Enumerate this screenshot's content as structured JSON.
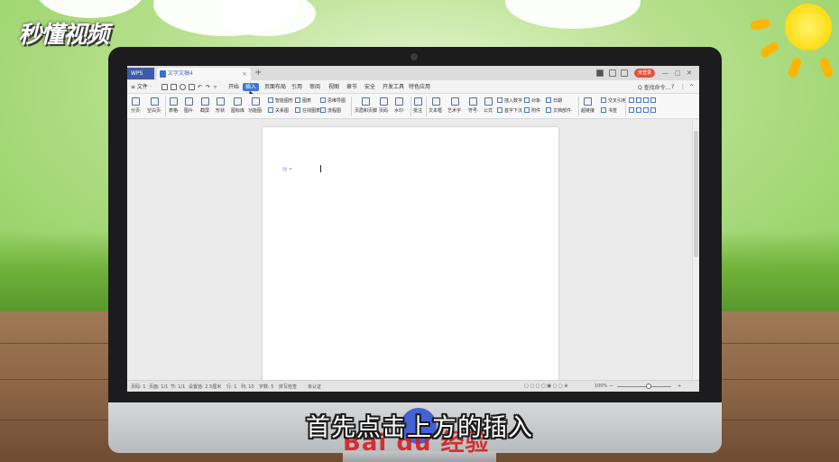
{
  "brand": {
    "logo_text": "秒懂视频",
    "watermark_text": "Bai du 经验"
  },
  "subtitle": "首先点击上方的插入",
  "colors": {
    "accent": "#3c76d8",
    "wps_tab": "#3f5aa8",
    "login": "#e0533f",
    "watermark": "#d62020"
  },
  "titlebar": {
    "app_tab": "WPS",
    "doc_tab": "文字文稿4",
    "new_tab": "+",
    "login": "未登录",
    "controls": [
      "—",
      "▢",
      "✕"
    ]
  },
  "menubar": {
    "file": "≡ 文件 ·",
    "items": [
      "开始",
      "插入",
      "页面布局",
      "引用",
      "审阅",
      "视图",
      "章节",
      "安全",
      "开发工具",
      "特色应用"
    ],
    "active_index": 1,
    "search": "Q 查找命令...",
    "help": "?",
    "more": "⋮",
    "collapse": "^"
  },
  "ribbon": {
    "big": [
      "分页·",
      "空白页·",
      "表格·",
      "图片·",
      "截屏·",
      "形状·",
      "图标库",
      "功能图·",
      "页眉和页脚",
      "页码·",
      "水印·",
      "批注",
      "文本框·",
      "艺术字·",
      "符号·",
      "公式"
    ],
    "small": [
      "智能图形",
      "图表",
      "关系图",
      "在线图表",
      "思维导图",
      "流程图",
      "插入数字",
      "对象·",
      "日期",
      "首字下沉",
      "附件",
      "文档部件·",
      "超链接",
      "交叉引用",
      "书签"
    ]
  },
  "status": {
    "page": "页码: 1",
    "pages": "页面: 1/1",
    "section": "节: 1/1",
    "setting": "设置值: 2.5厘米",
    "row": "行: 1",
    "col": "列: 10",
    "words": "字数: 5",
    "spell": "拼写检查",
    "cert": "未认证",
    "zoom": "100%",
    "zoom_minus": "—",
    "zoom_plus": "+"
  }
}
